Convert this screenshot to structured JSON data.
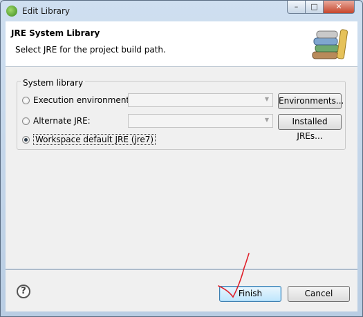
{
  "window": {
    "title": "Edit Library",
    "min_symbol": "–",
    "max_symbol": "□",
    "close_symbol": "✕"
  },
  "banner": {
    "title": "JRE System Library",
    "message": "Select JRE for the project build path.",
    "icon": "library-books-icon"
  },
  "group": {
    "legend": "System library"
  },
  "options": [
    {
      "label": "Execution environment:",
      "selected": false,
      "button": "Environments...",
      "combo_value": ""
    },
    {
      "label": "Alternate JRE:",
      "selected": false,
      "button": "Installed JREs...",
      "combo_value": ""
    },
    {
      "label": "Workspace default JRE (jre7)",
      "selected": true
    }
  ],
  "footer": {
    "help_symbol": "?",
    "finish_label": "Finish",
    "cancel_label": "Cancel"
  },
  "colors": {
    "accent": "#3c7fb1",
    "annotation_stroke": "#e0202a"
  }
}
